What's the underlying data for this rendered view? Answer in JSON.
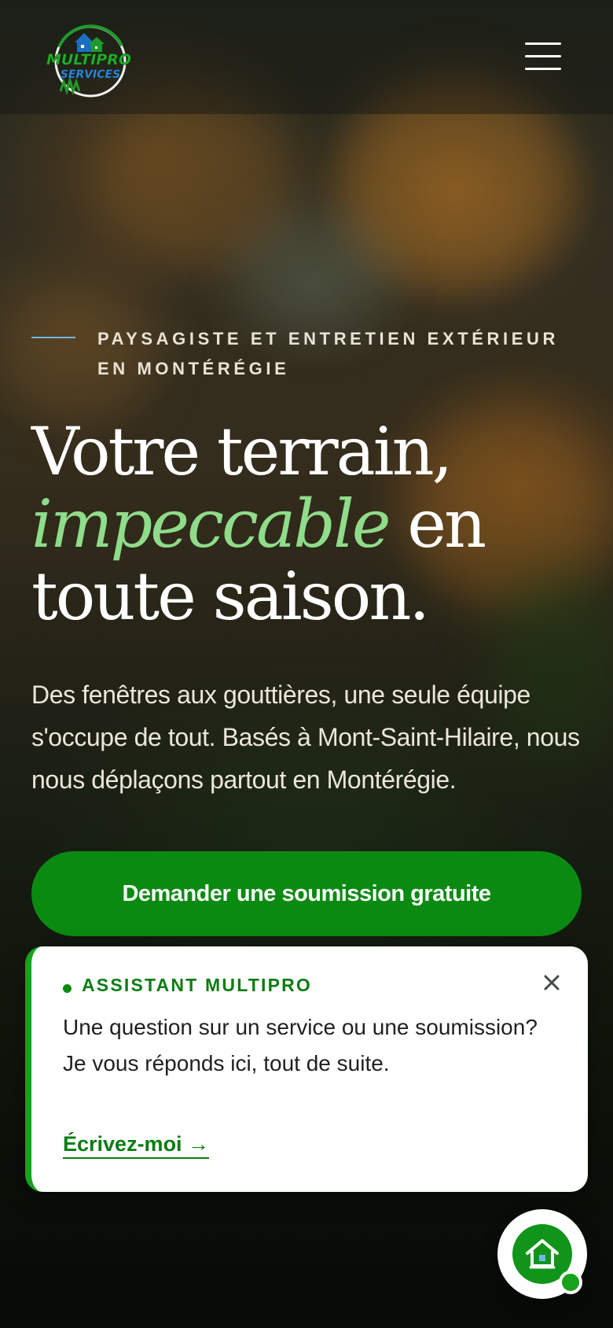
{
  "colors": {
    "accent_green": "#0b8a12",
    "headline_accent": "#8fdc8a",
    "eyebrow_line": "#6fb8e6",
    "chat_accent": "#16a21a"
  },
  "header": {
    "logo": {
      "line1": "MULTIPRO",
      "line2": "SERVICES",
      "icon": "house-logo-icon"
    },
    "menu_icon": "hamburger-menu-icon"
  },
  "hero": {
    "eyebrow": "PAYSAGISTE ET ENTRETIEN EXTÉRIEUR EN MONTÉRÉGIE",
    "headline_part1": "Votre terrain,",
    "headline_accent": "impeccable",
    "headline_part2": "en",
    "headline_part3": "toute saison.",
    "lead": "Des fenêtres aux gouttières, une seule équipe s'occupe de tout. Basés à Mont-Saint-Hilaire, nous nous déplaçons partout en Montérégie.",
    "cta_label": "Demander une soumission gratuite"
  },
  "chat": {
    "label": "ASSISTANT MULTIPRO",
    "message": "Une question sur un service ou une soumission? Je vous réponds ici, tout de suite.",
    "link_label": "Écrivez-moi →",
    "close_icon": "close-icon"
  },
  "fab": {
    "icon": "house-chat-icon"
  }
}
